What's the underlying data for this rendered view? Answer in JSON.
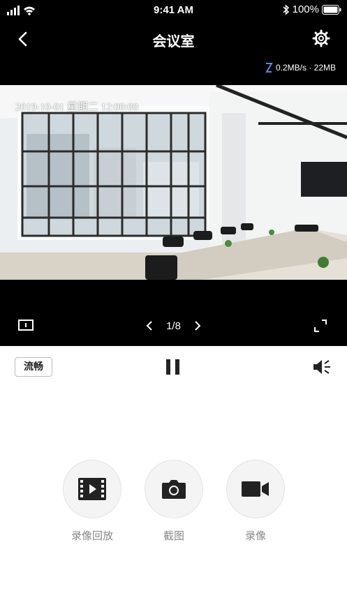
{
  "status_bar": {
    "time": "9:41 AM",
    "battery": "100%"
  },
  "header": {
    "title": "会议室"
  },
  "stream": {
    "speed": "0.2MB/s · 22MB"
  },
  "video": {
    "timestamp": "2019-10-01 星期二 12:00:00"
  },
  "pager": {
    "current": "1/8"
  },
  "toolbar": {
    "quality_label": "流畅"
  },
  "actions": [
    {
      "label": "录像回放",
      "icon": "film-icon"
    },
    {
      "label": "截图",
      "icon": "camera-icon"
    },
    {
      "label": "录像",
      "icon": "video-camera-icon"
    }
  ]
}
